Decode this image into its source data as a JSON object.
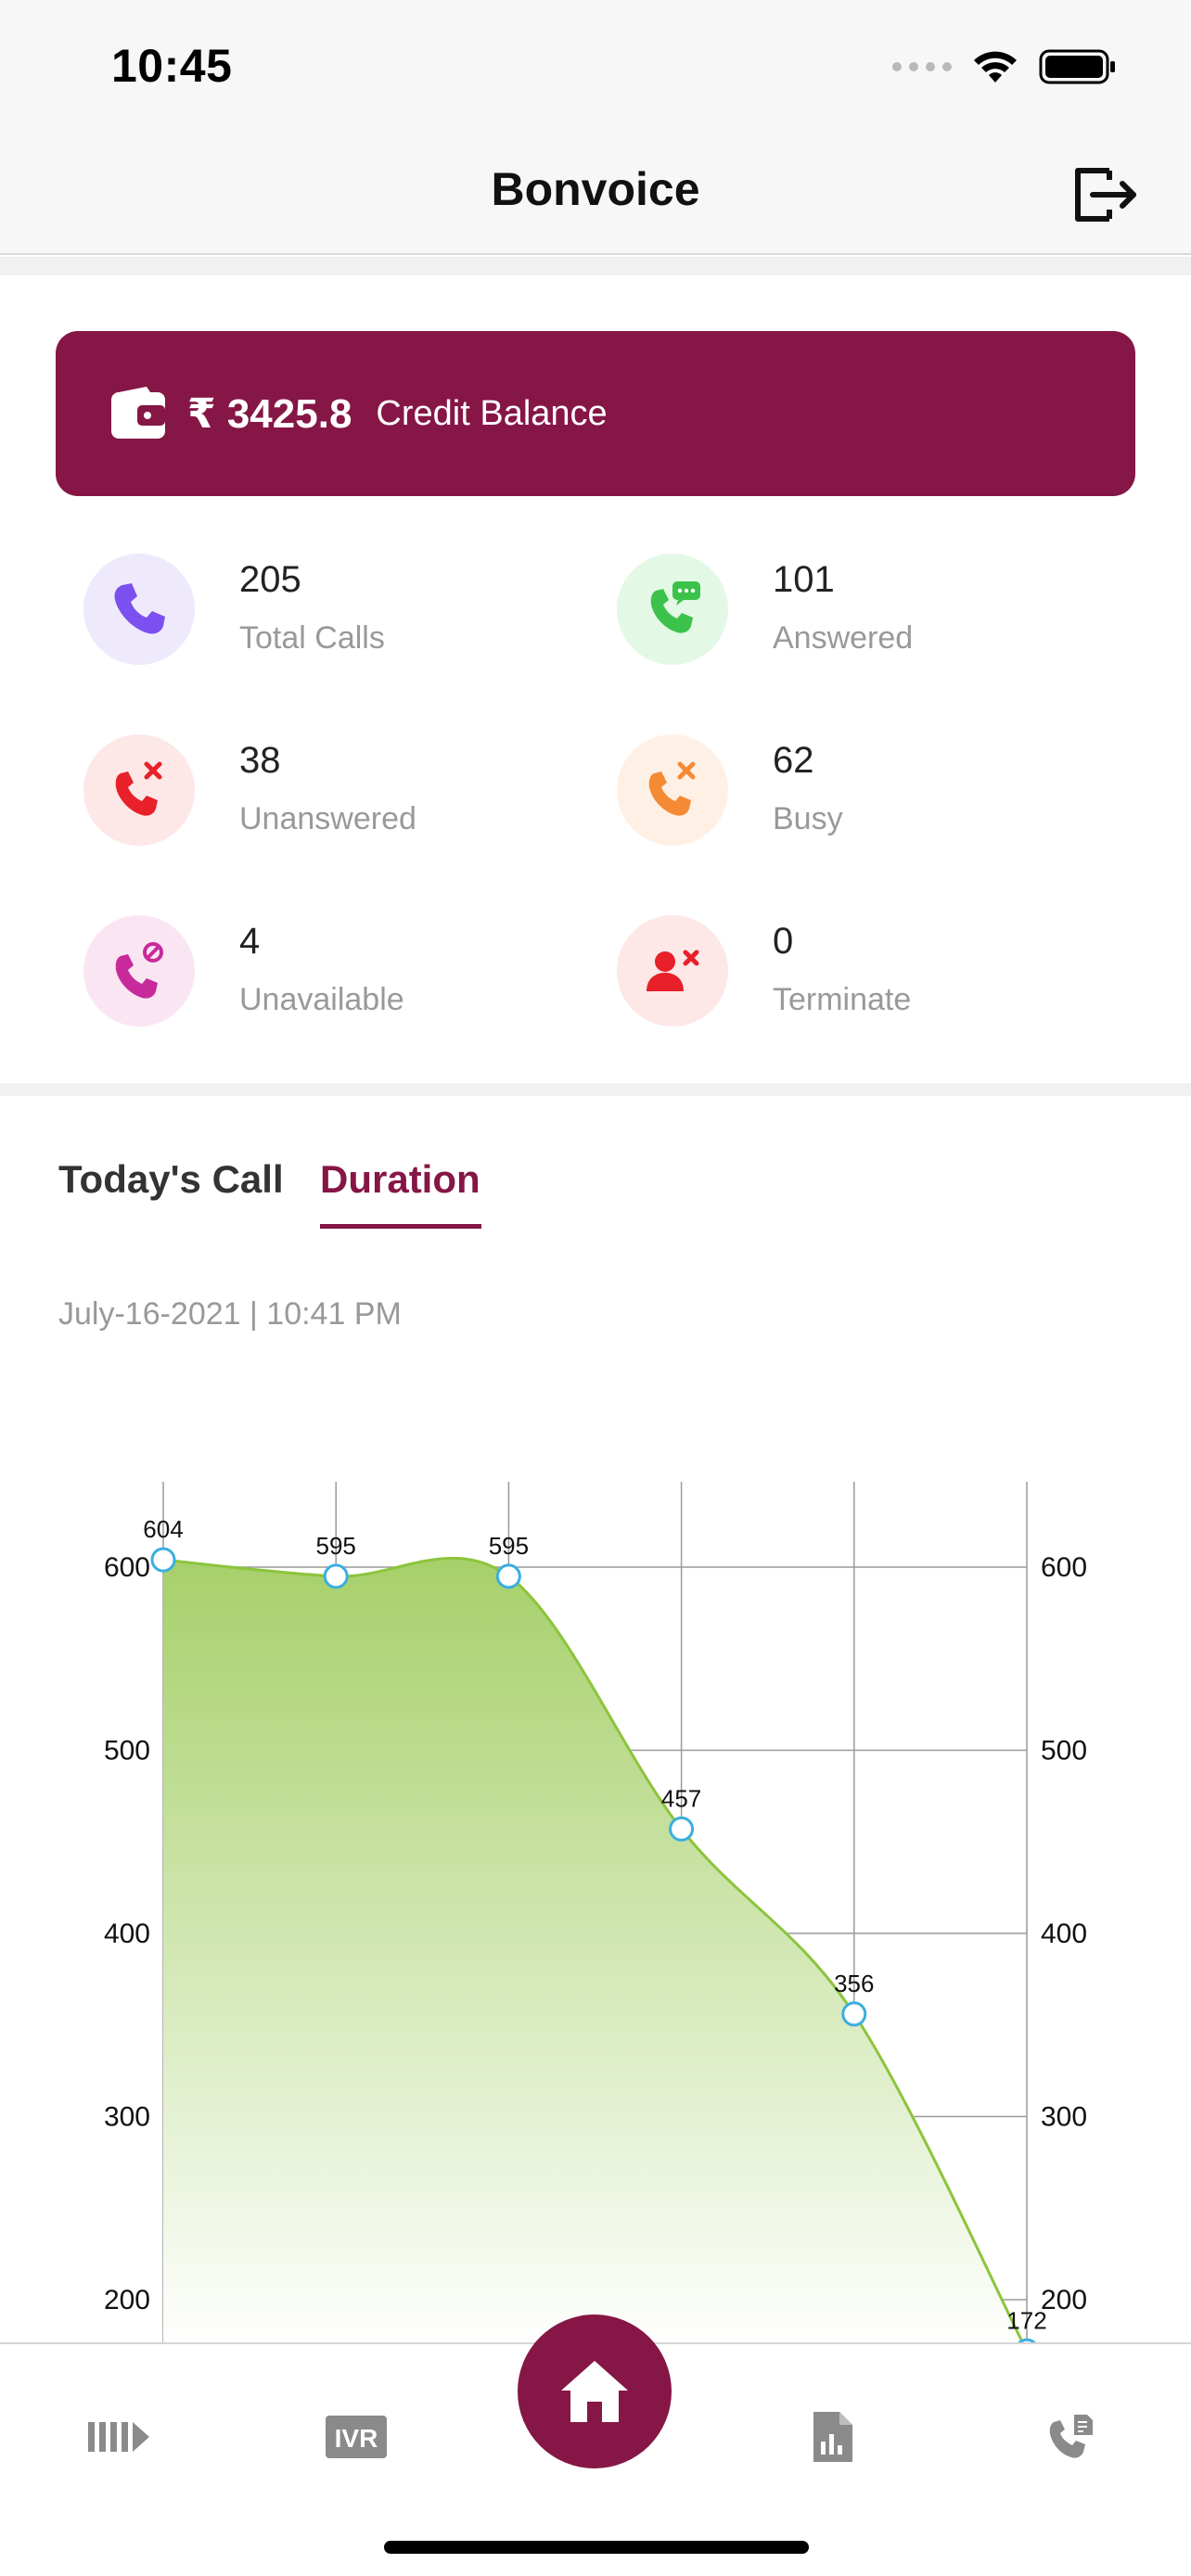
{
  "status_bar": {
    "time": "10:45"
  },
  "header": {
    "title": "Bonvoice"
  },
  "credit": {
    "amount": "₹ 3425.8",
    "label": "Credit Balance"
  },
  "stats": [
    {
      "value": "205",
      "label": "Total Calls",
      "icon": "phone-icon",
      "bg": "#eeeafc",
      "color": "#7b4ff0"
    },
    {
      "value": "101",
      "label": "Answered",
      "icon": "phone-message-icon",
      "bg": "#e4f8e6",
      "color": "#3cc24a"
    },
    {
      "value": "38",
      "label": "Unanswered",
      "icon": "phone-missed-icon",
      "bg": "#fde7e7",
      "color": "#e8202a"
    },
    {
      "value": "62",
      "label": "Busy",
      "icon": "phone-busy-icon",
      "bg": "#fff0e6",
      "color": "#f58a35"
    },
    {
      "value": "4",
      "label": "Unavailable",
      "icon": "phone-blocked-icon",
      "bg": "#fae6f3",
      "color": "#c82a9b"
    },
    {
      "value": "0",
      "label": "Terminate",
      "icon": "user-remove-icon",
      "bg": "#fde7e7",
      "color": "#e8202a"
    }
  ],
  "tabs": [
    {
      "label": "Today's Call",
      "active": false
    },
    {
      "label": "Duration",
      "active": true
    }
  ],
  "timestamp": "July-16-2021 | 10:41 PM",
  "chart_data": {
    "type": "area",
    "x": [
      1,
      2,
      3,
      4,
      5,
      6
    ],
    "values": [
      604,
      595,
      595,
      457,
      356,
      172
    ],
    "data_labels": [
      "604",
      "595",
      "595",
      "457",
      "356",
      "172"
    ],
    "y_ticks": [
      "200",
      "300",
      "400",
      "500",
      "600"
    ],
    "ylim": [
      155,
      650
    ],
    "grid": true,
    "colors": {
      "fill_top": "#a6d06a",
      "fill_bottom": "#ffffff",
      "line": "#8cc43c",
      "marker": "#3aaee0"
    }
  },
  "bottom_nav": [
    {
      "icon": "queue-icon"
    },
    {
      "icon": "ivr-icon",
      "label": "IVR"
    },
    {
      "icon": "home-icon"
    },
    {
      "icon": "report-icon"
    },
    {
      "icon": "call-log-icon"
    }
  ],
  "colors": {
    "brand": "#851646"
  }
}
